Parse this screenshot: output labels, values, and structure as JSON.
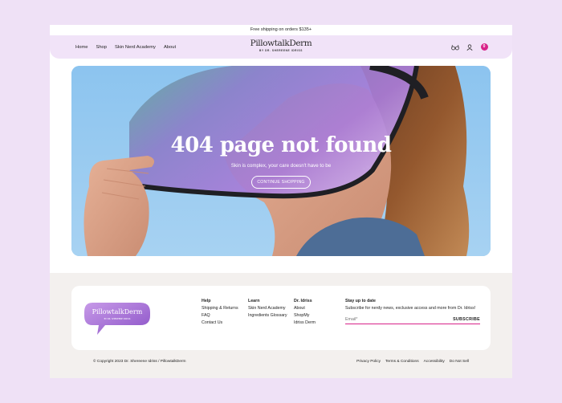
{
  "announcement": "Free shipping on orders $135+",
  "nav": [
    "Home",
    "Shop",
    "Skin Nerd Academy",
    "About"
  ],
  "brand": {
    "name": "PillowtalkDerm",
    "byline": "BY DR. SHEREENE IDRISS"
  },
  "header_icons": [
    "search-icon",
    "user-icon"
  ],
  "cart": {
    "count": "0",
    "color": "#d8238a"
  },
  "hero": {
    "title": "404 page not found",
    "subtitle": "Skin is complex, your care doesn't have to be",
    "button": "CONTINUE SHOPPING"
  },
  "footer": {
    "columns": [
      {
        "heading": "Help",
        "links": [
          "Shipping & Returns",
          "FAQ",
          "Contact Us"
        ]
      },
      {
        "heading": "Learn",
        "links": [
          "Skin Nerd Academy",
          "Ingredients Glossary"
        ]
      },
      {
        "heading": "Dr. Idriss",
        "links": [
          "About",
          "ShopMy",
          "Idriss Derm"
        ]
      }
    ],
    "newsletter": {
      "heading": "Stay up to date",
      "text": "Subscribe for nerdy news, exclusive access and more from Dr. Idriss!",
      "placeholder": "Email*",
      "button": "SUBSCRIBE"
    },
    "copyright": "© Copyright 2023 Dr. Shereene Idriss / PillowtalkDerm",
    "legal": [
      "Privacy Policy",
      "Terms & Conditions",
      "Accessibility",
      "Do Not Sell"
    ]
  },
  "colors": {
    "background": "#efe1f6",
    "header": "#f1e3f8",
    "accent": "#d8238a",
    "sky": "#8fc6ee"
  }
}
